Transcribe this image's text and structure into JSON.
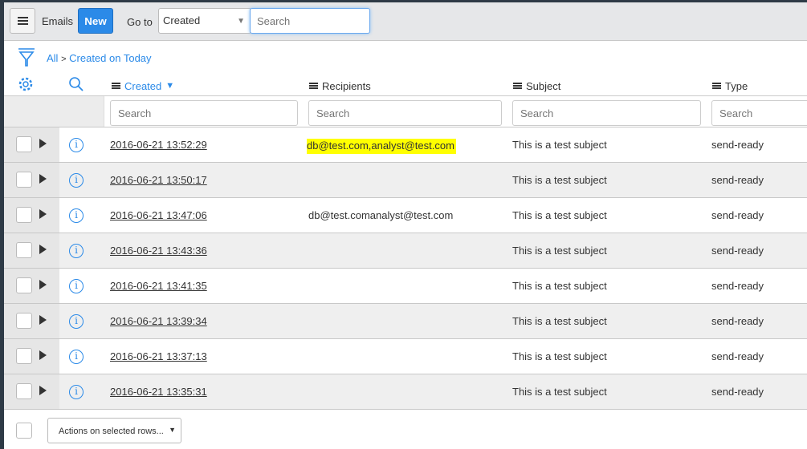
{
  "header": {
    "title": "Emails",
    "new_label": "New",
    "goto_label": "Go to",
    "goto_value": "Created",
    "search_placeholder": "Search"
  },
  "breadcrumb": {
    "all": "All",
    "separator": ">",
    "filter": "Created on Today"
  },
  "columns": [
    {
      "label": "Created",
      "sorted": "desc"
    },
    {
      "label": "Recipients"
    },
    {
      "label": "Subject"
    },
    {
      "label": "Type"
    }
  ],
  "column_search_placeholder": "Search",
  "rows": [
    {
      "created": "2016-06-21 13:52:29",
      "recipients": "db@test.com,analyst@test.com",
      "subject": "This is a test subject",
      "type": "send-ready",
      "highlighted": true
    },
    {
      "created": "2016-06-21 13:50:17",
      "recipients": "",
      "subject": "This is a test subject",
      "type": "send-ready"
    },
    {
      "created": "2016-06-21 13:47:06",
      "recipients": "db@test.comanalyst@test.com",
      "subject": "This is a test subject",
      "type": "send-ready"
    },
    {
      "created": "2016-06-21 13:43:36",
      "recipients": "",
      "subject": "This is a test subject",
      "type": "send-ready"
    },
    {
      "created": "2016-06-21 13:41:35",
      "recipients": "",
      "subject": "This is a test subject",
      "type": "send-ready"
    },
    {
      "created": "2016-06-21 13:39:34",
      "recipients": "",
      "subject": "This is a test subject",
      "type": "send-ready"
    },
    {
      "created": "2016-06-21 13:37:13",
      "recipients": "",
      "subject": "This is a test subject",
      "type": "send-ready"
    },
    {
      "created": "2016-06-21 13:35:31",
      "recipients": "",
      "subject": "This is a test subject",
      "type": "send-ready"
    }
  ],
  "footer": {
    "actions_label": "Actions on selected rows..."
  }
}
